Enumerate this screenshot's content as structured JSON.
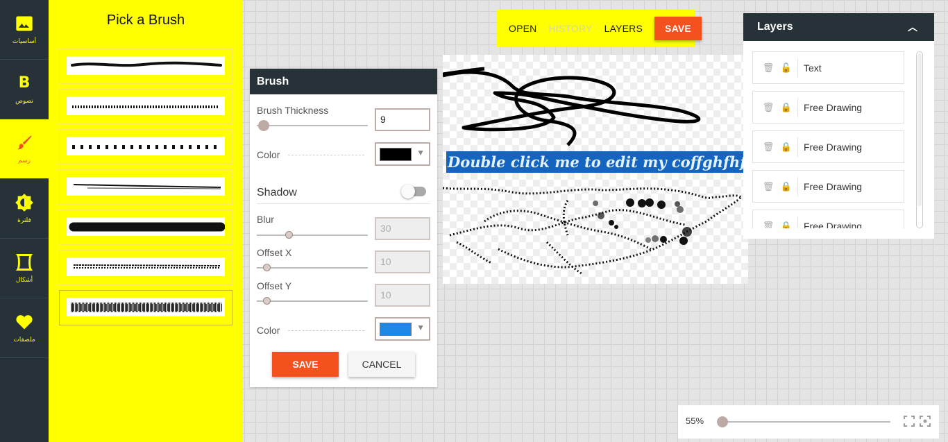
{
  "nav": [
    {
      "label": "أساسيات",
      "icon": "image-icon"
    },
    {
      "label": "نصوص",
      "icon": "bold-b-icon"
    },
    {
      "label": "رسم",
      "icon": "brush-icon"
    },
    {
      "label": "فلترة",
      "icon": "brightness-icon"
    },
    {
      "label": "أشكال",
      "icon": "shape-icon"
    },
    {
      "label": "ملصقات",
      "icon": "heart-icon"
    }
  ],
  "picker": {
    "title": "Pick a Brush",
    "brushes": [
      "pencil",
      "dotted",
      "diamond",
      "double-line",
      "blobby",
      "dashed-thick",
      "spray"
    ],
    "selected": 6
  },
  "toolbar": {
    "open": "OPEN",
    "history": "HISTORY",
    "layers": "LAYERS",
    "save": "SAVE"
  },
  "canvas": {
    "text_object": "Double click me to edit my coffghfhfhftents"
  },
  "brush_dialog": {
    "title": "Brush",
    "thickness_label": "Brush Thickness",
    "thickness_value": "9",
    "color_label": "Color",
    "color_value": "#000000",
    "shadow_title": "Shadow",
    "shadow_enabled": false,
    "blur_label": "Blur",
    "blur_value": "30",
    "offset_x_label": "Offset X",
    "offset_x_value": "10",
    "offset_y_label": "Offset Y",
    "offset_y_value": "10",
    "shadow_color_label": "Color",
    "shadow_color_value": "#1e88e5",
    "save": "SAVE",
    "cancel": "CANCEL"
  },
  "layers": {
    "title": "Layers",
    "items": [
      {
        "name": "Text",
        "locked": false
      },
      {
        "name": "Free Drawing",
        "locked": true
      },
      {
        "name": "Free Drawing",
        "locked": true
      },
      {
        "name": "Free Drawing",
        "locked": true
      },
      {
        "name": "Free Drawing",
        "locked": true
      }
    ]
  },
  "zoom": {
    "label": "55%",
    "level": 0.55
  },
  "colors": {
    "accent_yellow": "#ffff00",
    "accent_orange": "#f4511e",
    "dark": "#263238"
  }
}
